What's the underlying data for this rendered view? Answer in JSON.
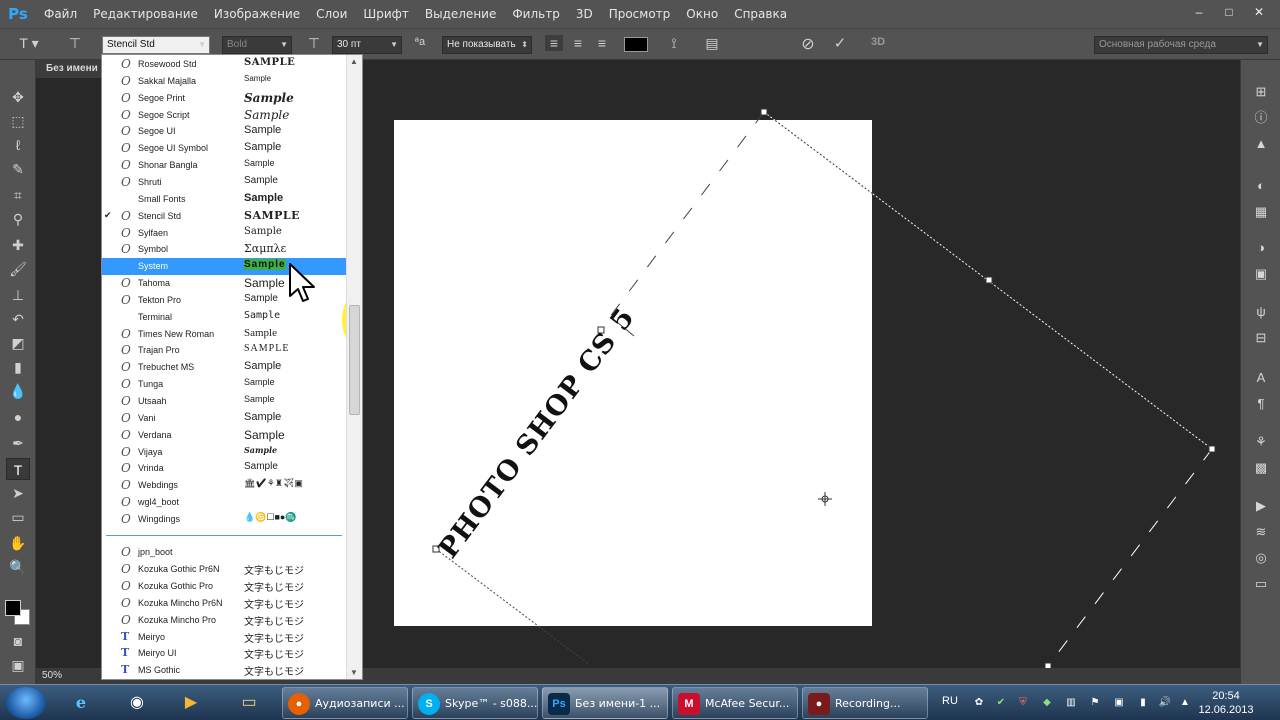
{
  "app": {
    "logo": "Ps",
    "menu": [
      "Файл",
      "Редактирование",
      "Изображение",
      "Слои",
      "Шрифт",
      "Выделение",
      "Фильтр",
      "3D",
      "Просмотр",
      "Окно",
      "Справка"
    ],
    "window_controls": [
      "–",
      "□",
      "✕"
    ]
  },
  "options": {
    "font_family": "Stencil Std",
    "font_style": "Bold",
    "font_size": "30 пт",
    "antialias": "Не показывать",
    "workspace": "Основная рабочая среда",
    "label_3d": "3D",
    "text_color": "#000000"
  },
  "document": {
    "tab_title": "Без имени",
    "zoom": "50%",
    "text_content": "PHOTO SHOP CS 5"
  },
  "font_list": {
    "fonts": [
      {
        "name": "Rosewood Std",
        "sample": "SAMPLE",
        "icon": "O",
        "checked": ""
      },
      {
        "name": "Sakkal Majalla",
        "sample": "Sample",
        "icon": "O",
        "checked": ""
      },
      {
        "name": "Segoe Print",
        "sample": "Sample",
        "icon": "O",
        "checked": ""
      },
      {
        "name": "Segoe Script",
        "sample": "Sample",
        "icon": "O",
        "checked": ""
      },
      {
        "name": "Segoe UI",
        "sample": "Sample",
        "icon": "O",
        "checked": ""
      },
      {
        "name": "Segoe UI Symbol",
        "sample": "Sample",
        "icon": "O",
        "checked": ""
      },
      {
        "name": "Shonar Bangla",
        "sample": "Sample",
        "icon": "O",
        "checked": ""
      },
      {
        "name": "Shruti",
        "sample": "Sample",
        "icon": "O",
        "checked": ""
      },
      {
        "name": "Small Fonts",
        "sample": "Sample",
        "icon": "",
        "checked": ""
      },
      {
        "name": "Stencil Std",
        "sample": "SAMPLE",
        "icon": "O",
        "checked": "✔"
      },
      {
        "name": "Sylfaen",
        "sample": "Sample",
        "icon": "O",
        "checked": ""
      },
      {
        "name": "Symbol",
        "sample": "Σαμπλε",
        "icon": "O",
        "checked": ""
      },
      {
        "name": "System",
        "sample": "Sample",
        "icon": "",
        "checked": ""
      },
      {
        "name": "Tahoma",
        "sample": "Sample",
        "icon": "O",
        "checked": ""
      },
      {
        "name": "Tekton Pro",
        "sample": "Sample",
        "icon": "O",
        "checked": ""
      },
      {
        "name": "Terminal",
        "sample": "Sample",
        "icon": "",
        "checked": ""
      },
      {
        "name": "Times New Roman",
        "sample": "Sample",
        "icon": "O",
        "checked": ""
      },
      {
        "name": "Trajan Pro",
        "sample": "SAMPLE",
        "icon": "O",
        "checked": ""
      },
      {
        "name": "Trebuchet MS",
        "sample": "Sample",
        "icon": "O",
        "checked": ""
      },
      {
        "name": "Tunga",
        "sample": "Sample",
        "icon": "O",
        "checked": ""
      },
      {
        "name": "Utsaah",
        "sample": "Sample",
        "icon": "O",
        "checked": ""
      },
      {
        "name": "Vani",
        "sample": "Sample",
        "icon": "O",
        "checked": ""
      },
      {
        "name": "Verdana",
        "sample": "Sample",
        "icon": "O",
        "checked": ""
      },
      {
        "name": "Vijaya",
        "sample": "Sample",
        "icon": "O",
        "checked": ""
      },
      {
        "name": "Vrinda",
        "sample": "Sample",
        "icon": "O",
        "checked": ""
      },
      {
        "name": "Webdings",
        "sample": "🏛✔⚘♜✈▣",
        "icon": "O",
        "checked": ""
      },
      {
        "name": "wgl4_boot",
        "sample": "",
        "icon": "O",
        "checked": ""
      },
      {
        "name": "Wingdings",
        "sample": "💧♋☐■●♏",
        "icon": "O",
        "checked": ""
      }
    ],
    "cjk_fonts": [
      {
        "name": "jpn_boot",
        "sample": "",
        "icon": "O"
      },
      {
        "name": "Kozuka Gothic Pr6N",
        "sample": "文字もじモジ",
        "icon": "O"
      },
      {
        "name": "Kozuka Gothic Pro",
        "sample": "文字もじモジ",
        "icon": "O"
      },
      {
        "name": "Kozuka Mincho Pr6N",
        "sample": "文字もじモジ",
        "icon": "O"
      },
      {
        "name": "Kozuka Mincho Pro",
        "sample": "文字もじモジ",
        "icon": "O"
      },
      {
        "name": "Meiryo",
        "sample": "文字もじモジ",
        "icon": "T"
      },
      {
        "name": "Meiryo UI",
        "sample": "文字もじモジ",
        "icon": "T"
      },
      {
        "name": "MS Gothic",
        "sample": "文字もじモジ",
        "icon": "T"
      }
    ],
    "selected_font": "System"
  },
  "taskbar": {
    "tasks": [
      "Аудиозаписи ...",
      "Skype™ - s088...",
      "Без имени-1 ...",
      "McAfee Secur...",
      "Recording..."
    ],
    "language": "RU",
    "time": "20:54",
    "date": "12.06.2013"
  },
  "colors": {
    "accent_selection": "#3399ff",
    "highlight": "#fff000",
    "ps_blue": "#31a8ff"
  }
}
